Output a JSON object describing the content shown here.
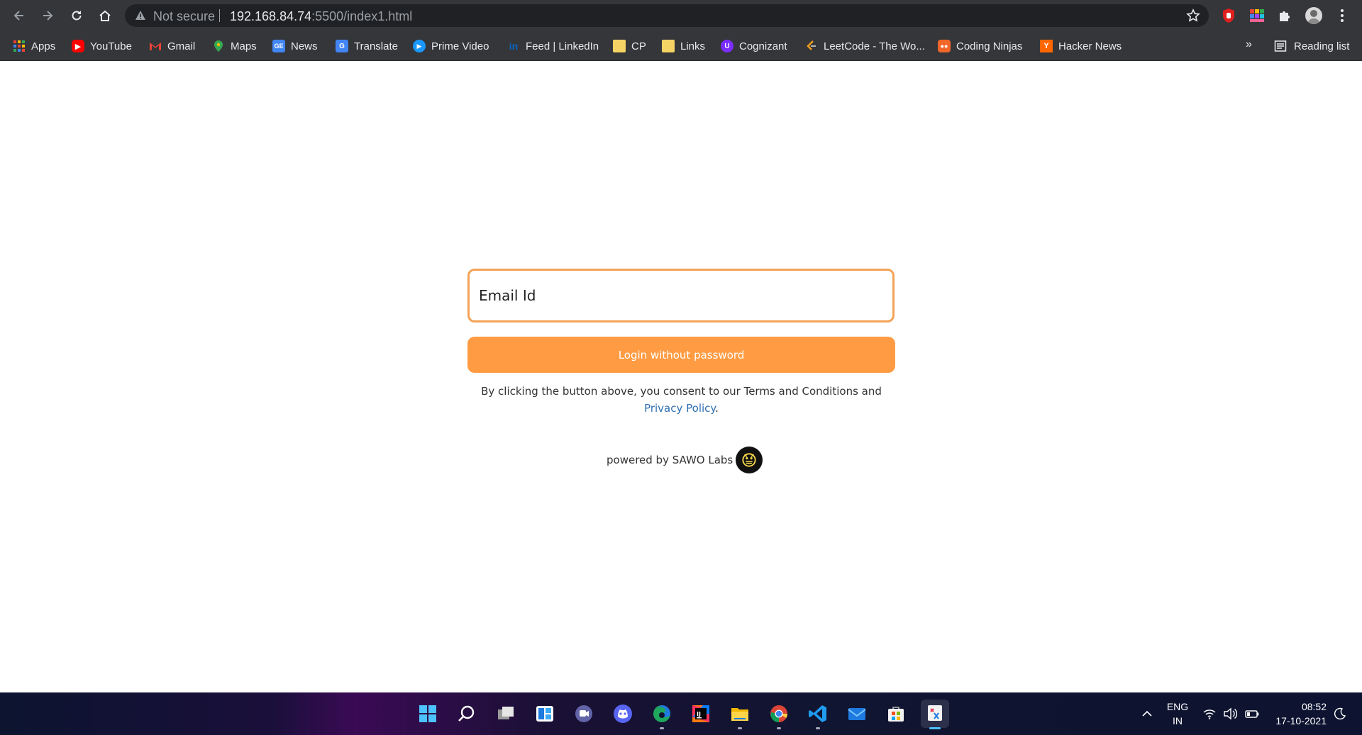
{
  "browser": {
    "security_label": "Not secure",
    "url_host": "192.168.84.74",
    "url_path": ":5500/index1.html",
    "bookmarks": [
      {
        "label": "Apps",
        "icon": "apps-grid-icon",
        "color": "#ea4335"
      },
      {
        "label": "YouTube",
        "icon": "youtube-icon",
        "color": "#ff0000"
      },
      {
        "label": "Gmail",
        "icon": "gmail-icon",
        "color": "#ea4335"
      },
      {
        "label": "Maps",
        "icon": "maps-icon",
        "color": "#34a853"
      },
      {
        "label": "News",
        "icon": "news-icon",
        "color": "#4285f4"
      },
      {
        "label": "Translate",
        "icon": "translate-icon",
        "color": "#4285f4"
      },
      {
        "label": "Prime Video",
        "icon": "prime-video-icon",
        "color": "#1a98ff"
      },
      {
        "label": "Feed | LinkedIn",
        "icon": "linkedin-icon",
        "color": "#0a66c2"
      },
      {
        "label": "CP",
        "icon": "folder-icon",
        "color": "#f6d365"
      },
      {
        "label": "Links",
        "icon": "folder-icon",
        "color": "#f6d365"
      },
      {
        "label": "Cognizant",
        "icon": "cognizant-icon",
        "color": "#7b2cff"
      },
      {
        "label": "LeetCode - The Wo...",
        "icon": "leetcode-icon",
        "color": "#f89f1b"
      },
      {
        "label": "Coding Ninjas",
        "icon": "coding-ninjas-icon",
        "color": "#f2662a"
      },
      {
        "label": "Hacker News",
        "icon": "hacker-news-icon",
        "color": "#ff6600"
      }
    ],
    "more_label": "»",
    "reading_list_label": "Reading list"
  },
  "page": {
    "email_placeholder": "Email Id",
    "login_button": "Login without password",
    "consent_text": "By clicking the button above, you consent to our Terms and Conditions and ",
    "privacy_link": "Privacy Policy",
    "consent_end": ".",
    "powered_by": "powered by SAWO Labs",
    "accent_color": "#ff9c43"
  },
  "taskbar": {
    "apps": [
      "windows-start-icon",
      "search-icon",
      "task-view-icon",
      "widgets-icon",
      "teams-chat-icon",
      "discord-icon",
      "edge-icon",
      "intellij-icon",
      "file-explorer-icon",
      "chrome-icon",
      "vscode-icon",
      "mail-icon",
      "store-icon",
      "snipping-tool-icon"
    ],
    "lang_line1": "ENG",
    "lang_line2": "IN",
    "time": "08:52",
    "date": "17-10-2021"
  }
}
